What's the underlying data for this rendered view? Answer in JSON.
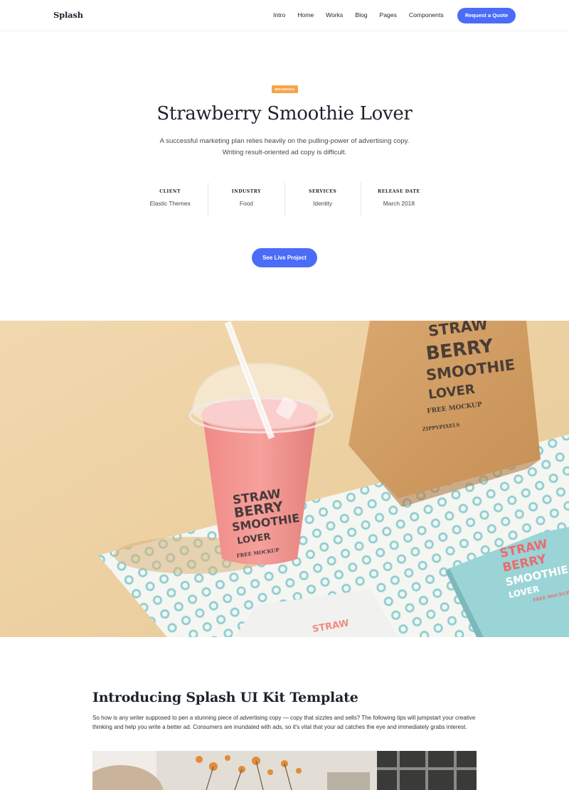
{
  "navbar": {
    "brand": "Splash",
    "links": [
      "Intro",
      "Home",
      "Works",
      "Blog",
      "Pages",
      "Components"
    ],
    "cta_label": "Request a Quote",
    "accent_color": "#4a6cf7"
  },
  "hero": {
    "badge": "BRANDING",
    "badge_color": "#f7a54a",
    "title": "Strawberry Smoothie Lover",
    "description_line1": "A successful marketing plan relies heavily on the pulling-power of advertising copy.",
    "description_line2": "Writing result-oriented ad copy is difficult.",
    "meta": [
      {
        "label": "CLIENT",
        "value": "Elastic Themes"
      },
      {
        "label": "INDUSTRY",
        "value": "Food"
      },
      {
        "label": "SERVICES",
        "value": "Identity"
      },
      {
        "label": "RELEASE DATE",
        "value": "March 2018"
      }
    ],
    "button_label": "See Live Project"
  },
  "mockup": {
    "cup_line1": "STRAW",
    "cup_line2": "BERRY",
    "cup_line3": "SMOOTHIE",
    "cup_line4": "LOVER",
    "cup_tag": "FREE MOCKUP",
    "bag_line1": "STRAW",
    "bag_line2": "BERRY",
    "bag_line3": "SMOOTHIE",
    "bag_line4": "LOVER",
    "bag_tag": "FREE MOCKUP",
    "bag_credit": "ZIPPYPIXELS",
    "box_line1": "STRAW",
    "box_line2": "BERRY",
    "box_line3": "SMOOTHIE",
    "box_line4": "LOVER",
    "box_tag": "FREE MOCKUP",
    "pouch_text": "STRAW"
  },
  "article": {
    "title": "Introducing Splash UI Kit Template",
    "body": "So how is any writer supposed to pen a stunning piece of advertising copy — copy that sizzles and sells? The following tips will jumpstart your creative thinking and help you write a better ad. Consumers are inundated with ads, so it's vital that your ad catches the eye and immediately grabs interest."
  }
}
